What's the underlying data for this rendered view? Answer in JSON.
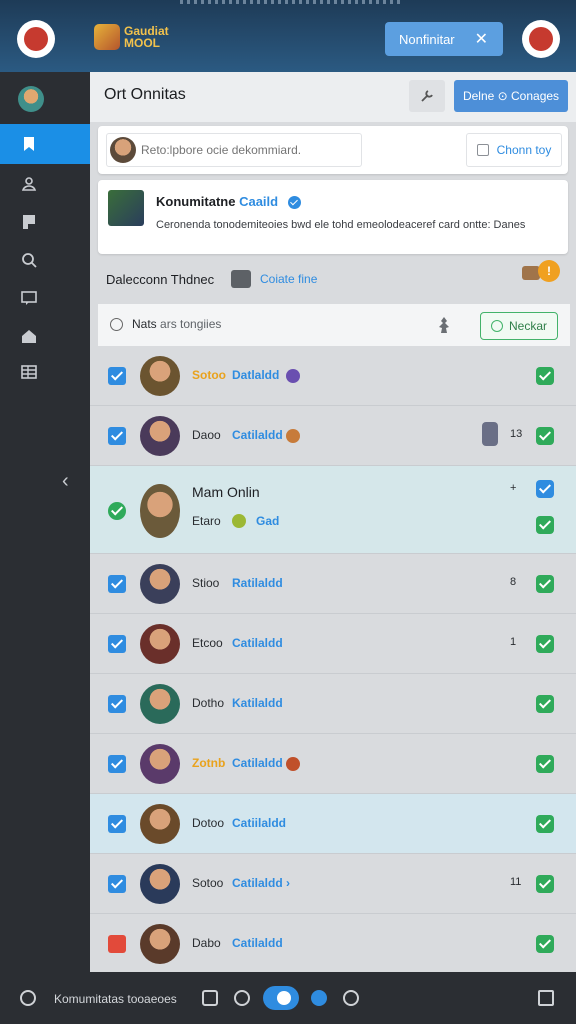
{
  "topbar": {
    "logo_line1": "Gaudiat",
    "logo_line2": "MOOL",
    "notif_label": "Nonfinitar",
    "close_glyph": "✕"
  },
  "header": {
    "title": "Ort Onnitas",
    "primary_label": "Delne ⊙ Conages"
  },
  "search": {
    "placeholder": "Reto:lpbore ocie dekommiard.",
    "right_label": "Chonn toy"
  },
  "info": {
    "title": "Konumitatne",
    "title_accent": "Caaild",
    "desc": "Ceronenda tonodemiteoies bwd ele tohd emeolodeaceref card ontte: Danes"
  },
  "section": {
    "title": "Dalecconn Thdnec",
    "link": "Coiate fine"
  },
  "filter": {
    "label": "Nats",
    "label_muted": "ars tongiies",
    "button": "Neckar"
  },
  "rows": [
    {
      "name": "Sotoo",
      "link": "Datlaldd",
      "gold": true,
      "count": "",
      "dot": "#6a4fb0",
      "av": "#6b5430",
      "chk": "blue"
    },
    {
      "name": "Daoo",
      "link": "Catilaldd",
      "gold": false,
      "count": "13",
      "dot": "#c77b3a",
      "av": "#4a3a5a",
      "chk": "blue"
    },
    {
      "title": "Mam Onlin",
      "name": "Etaro",
      "link": "Gad",
      "count": "+",
      "dot": "#9cb834",
      "av": "#6b5a3a",
      "chk": "green"
    },
    {
      "name": "Stioo",
      "link": "Ratilaldd",
      "gold": false,
      "count": "8",
      "dot": "",
      "av": "#3a3f5a",
      "chk": "blue"
    },
    {
      "name": "Etcoo",
      "link": "Catilaldd",
      "gold": false,
      "count": "1",
      "dot": "",
      "av": "#6a2f2a",
      "chk": "blue"
    },
    {
      "name": "Dotho",
      "link": "Katilaldd",
      "gold": false,
      "count": "",
      "dot": "",
      "av": "#2a6a5a",
      "chk": "blue"
    },
    {
      "name": "Zotnb",
      "link": "Catilaldd",
      "gold": true,
      "count": "",
      "dot": "#c0502a",
      "av": "#5a3a6a",
      "chk": "blue"
    },
    {
      "name": "Dotoo",
      "link": "Catiilaldd",
      "gold": false,
      "count": "",
      "dot": "",
      "av": "#6a4a2a",
      "chk": "blue"
    },
    {
      "name": "Sotoo",
      "link": "Catilaldd ›",
      "gold": false,
      "count": "11",
      "dot": "",
      "av": "#2a3a5a",
      "chk": "blue"
    },
    {
      "name": "Dabo",
      "link": "Catilaldd",
      "gold": false,
      "count": "",
      "dot": "",
      "av": "#5a3a2a",
      "chk": "red"
    }
  ],
  "bottombar": {
    "text": "Komumitatas tooaeoes"
  },
  "colors": {
    "accent": "#2f8ce0",
    "success": "#2faa5a",
    "warning": "#f0a020",
    "gold": "#e9a21c"
  }
}
